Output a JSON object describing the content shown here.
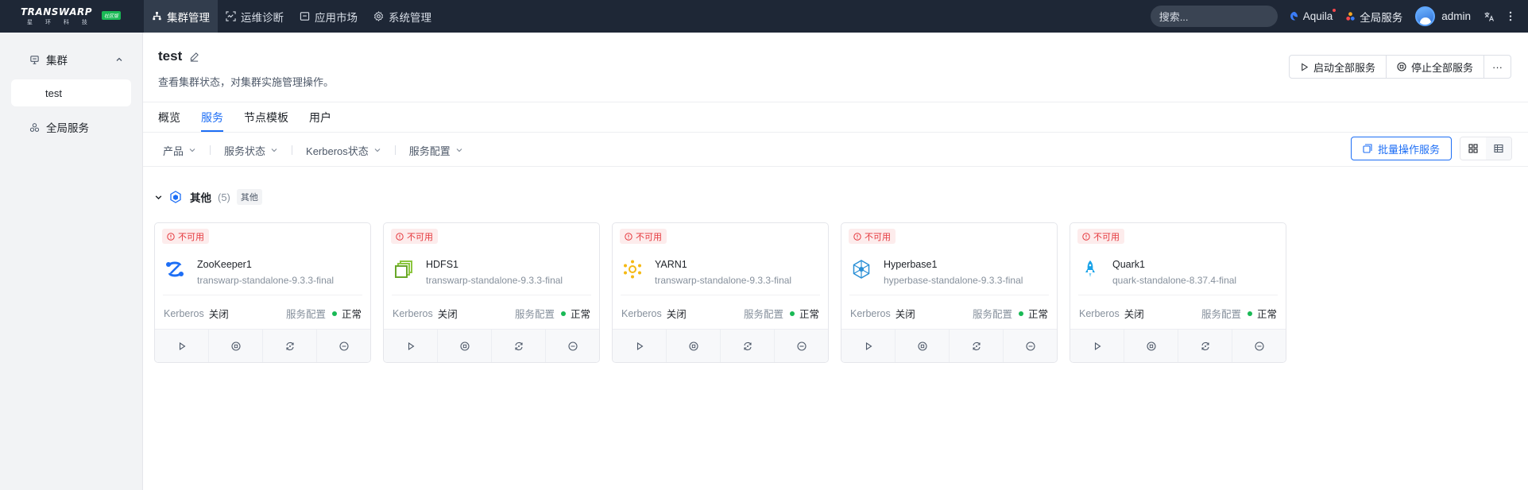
{
  "topbar": {
    "brand": "TRANSWARP",
    "brand_sub": "星 环 科 技",
    "brand_tag": "社区版",
    "nav": [
      {
        "label": "集群管理",
        "icon": "cluster-icon",
        "active": true
      },
      {
        "label": "运维诊断",
        "icon": "diagnose-icon",
        "active": false
      },
      {
        "label": "应用市场",
        "icon": "market-icon",
        "active": false
      },
      {
        "label": "系统管理",
        "icon": "gear-icon",
        "active": false
      }
    ],
    "search_placeholder": "搜索...",
    "aquila_label": "Aquila",
    "global_services_label": "全局服务",
    "user_name": "admin"
  },
  "sidebar": {
    "group_label": "集群",
    "cluster_item": "test",
    "global_item": "全局服务"
  },
  "header": {
    "title": "test",
    "subtitle": "查看集群状态，对集群实施管理操作。",
    "start_all": "启动全部服务",
    "stop_all": "停止全部服务",
    "more": "···"
  },
  "tabs": [
    {
      "label": "概览",
      "active": false
    },
    {
      "label": "服务",
      "active": true
    },
    {
      "label": "节点模板",
      "active": false
    },
    {
      "label": "用户",
      "active": false
    }
  ],
  "filters": [
    "产品",
    "服务状态",
    "Kerberos状态",
    "服务配置"
  ],
  "batch_button": "批量操作服务",
  "group": {
    "name": "其他",
    "count": "(5)",
    "tag": "其他"
  },
  "cards": [
    {
      "status": "不可用",
      "name": "ZooKeeper1",
      "version": "transwarp-standalone-9.3.3-final",
      "icon": "zookeeper-icon",
      "kerberos_label": "Kerberos",
      "kerberos_value": "关闭",
      "config_label": "服务配置",
      "config_value": "正常"
    },
    {
      "status": "不可用",
      "name": "HDFS1",
      "version": "transwarp-standalone-9.3.3-final",
      "icon": "hdfs-icon",
      "kerberos_label": "Kerberos",
      "kerberos_value": "关闭",
      "config_label": "服务配置",
      "config_value": "正常"
    },
    {
      "status": "不可用",
      "name": "YARN1",
      "version": "transwarp-standalone-9.3.3-final",
      "icon": "yarn-icon",
      "kerberos_label": "Kerberos",
      "kerberos_value": "关闭",
      "config_label": "服务配置",
      "config_value": "正常"
    },
    {
      "status": "不可用",
      "name": "Hyperbase1",
      "version": "hyperbase-standalone-9.3.3-final",
      "icon": "hyperbase-icon",
      "kerberos_label": "Kerberos",
      "kerberos_value": "关闭",
      "config_label": "服务配置",
      "config_value": "正常"
    },
    {
      "status": "不可用",
      "name": "Quark1",
      "version": "quark-standalone-8.37.4-final",
      "icon": "quark-icon",
      "kerberos_label": "Kerberos",
      "kerberos_value": "关闭",
      "config_label": "服务配置",
      "config_value": "正常"
    }
  ],
  "colors": {
    "topbar_bg": "#1e2736",
    "accent": "#1d6ef5",
    "error": "#e5383d",
    "ok": "#19b955"
  }
}
